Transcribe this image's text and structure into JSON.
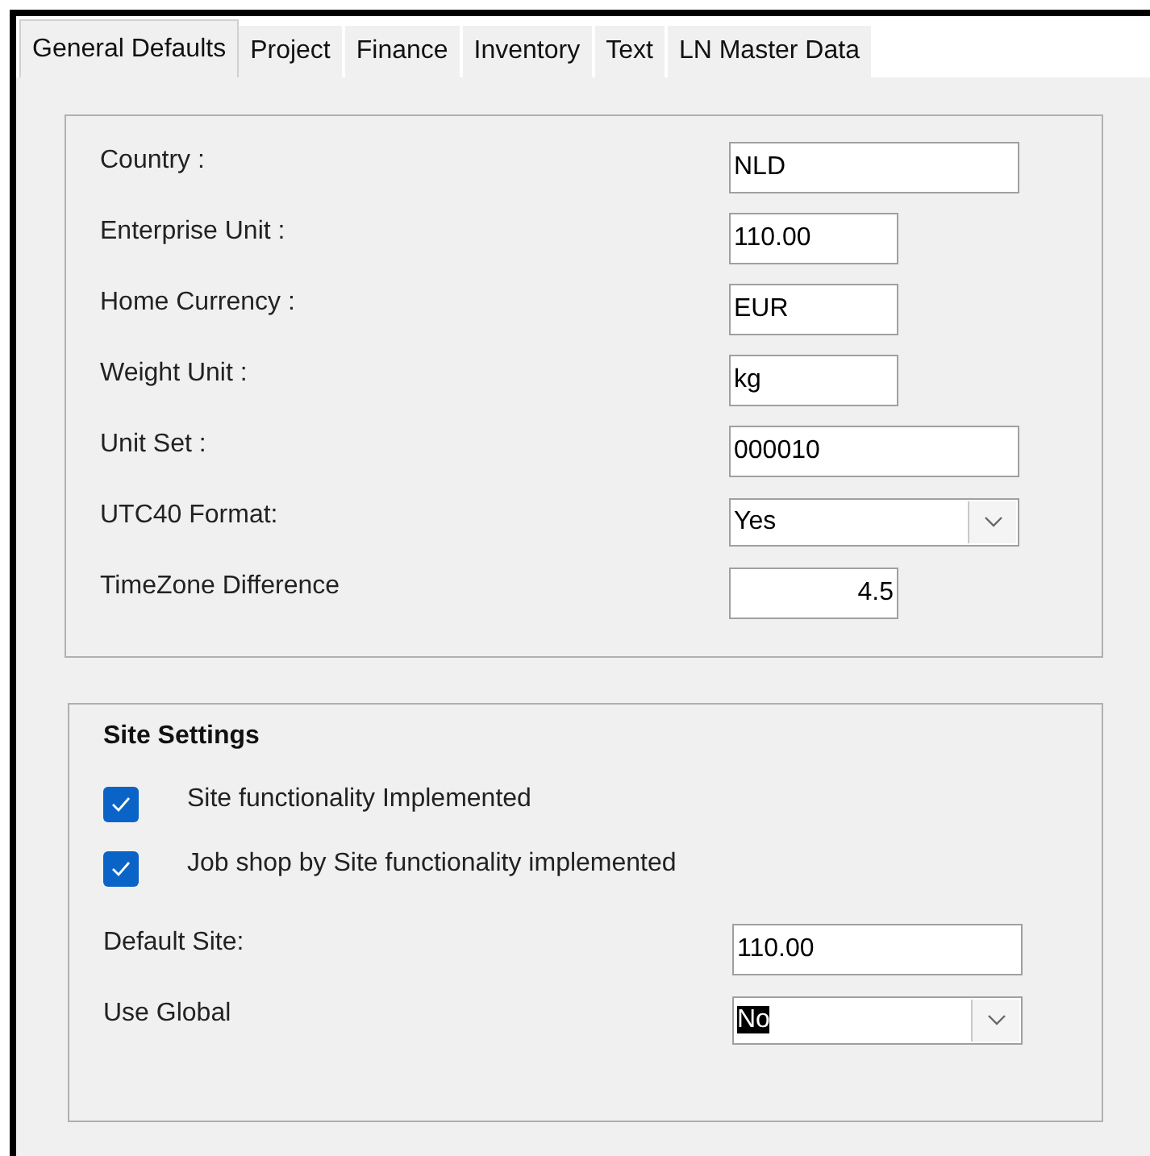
{
  "tabs": [
    {
      "label": "General Defaults",
      "selected": true
    },
    {
      "label": "Project",
      "selected": false
    },
    {
      "label": "Finance",
      "selected": false
    },
    {
      "label": "Inventory",
      "selected": false
    },
    {
      "label": "Text",
      "selected": false
    },
    {
      "label": "LN Master Data",
      "selected": false
    }
  ],
  "general": {
    "fields": [
      {
        "label": "Country :",
        "kind": "text",
        "wide": true,
        "value": "NLD"
      },
      {
        "label": "Enterprise Unit :",
        "kind": "text",
        "wide": false,
        "value": "110.00"
      },
      {
        "label": "Home Currency :",
        "kind": "text",
        "wide": false,
        "value": "EUR"
      },
      {
        "label": "Weight Unit :",
        "kind": "text",
        "wide": false,
        "value": "kg"
      },
      {
        "label": "Unit Set :",
        "kind": "text",
        "wide": true,
        "value": "000010"
      },
      {
        "label": "UTC40 Format:",
        "kind": "dropdown",
        "wide": true,
        "value": "Yes",
        "highlighted": false
      },
      {
        "label": "TimeZone Difference",
        "kind": "number",
        "wide": false,
        "value": "4.5"
      }
    ]
  },
  "site_settings": {
    "title": "Site Settings",
    "checkboxes": [
      {
        "label": "Site functionality Implemented",
        "checked": true
      },
      {
        "label": "Job shop by Site functionality implemented",
        "checked": true
      }
    ],
    "fields": [
      {
        "label": "Default Site:",
        "kind": "text",
        "wide": true,
        "value": "110.00"
      },
      {
        "label": "Use Global",
        "kind": "dropdown",
        "wide": true,
        "value": "No",
        "highlighted": true
      }
    ]
  }
}
